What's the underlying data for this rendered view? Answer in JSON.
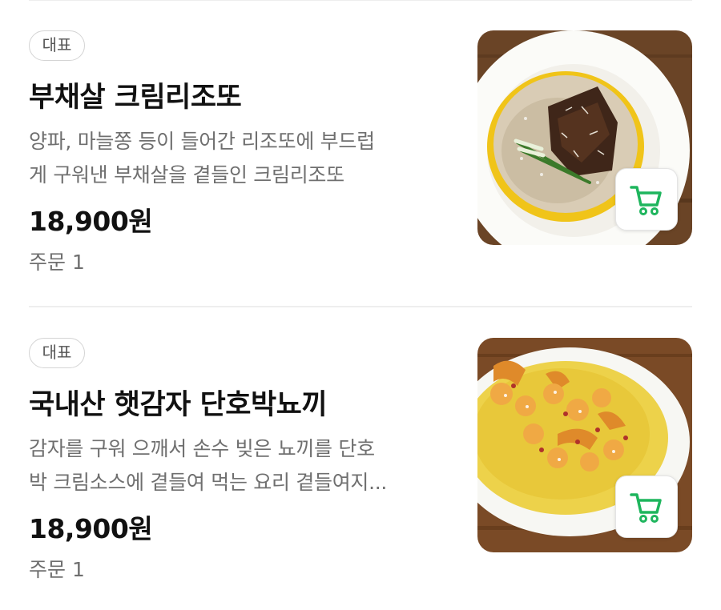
{
  "menu_items": [
    {
      "badge": "대표",
      "name": "부채살 크림리조또",
      "description_lines": [
        "양파, 마늘쫑 등이 들어간 리조또에 부드럽",
        "게 구워낸 부채살을 곁들인 크림리조또"
      ],
      "price": "18,900원",
      "orders": "주문 1",
      "image_icon": "risotto-photo",
      "cart_icon": "cart-icon"
    },
    {
      "badge": "대표",
      "name": "국내산 햇감자 단호박뇨끼",
      "description_lines": [
        "감자를 구워 으깨서 손수 빚은 뇨끼를 단호",
        "박 크림소스에 곁들여 먹는 요리 곁들여지..."
      ],
      "price": "18,900원",
      "orders": "주문 1",
      "image_icon": "gnocchi-photo",
      "cart_icon": "cart-icon"
    }
  ],
  "colors": {
    "accent_green": "#1eb55d",
    "text_primary": "#111111",
    "text_secondary": "#6f6f6f"
  }
}
